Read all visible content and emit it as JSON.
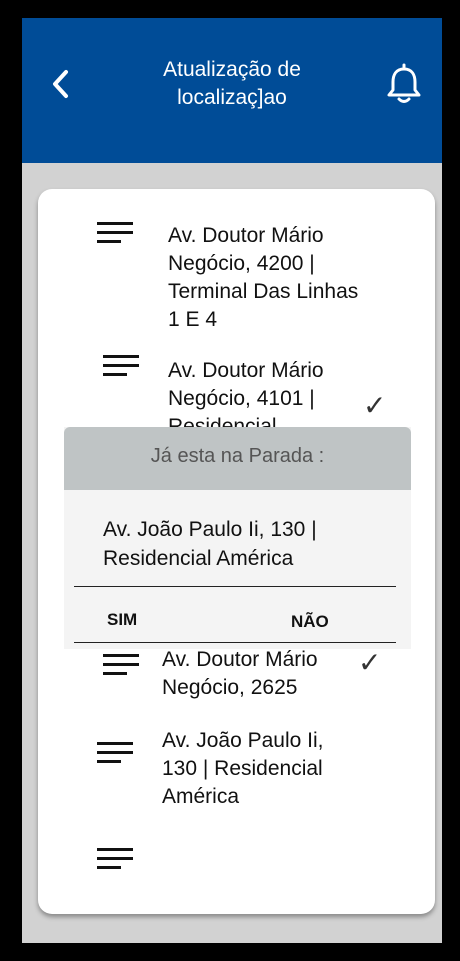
{
  "header": {
    "title_line1": "Atualização de",
    "title_line2": "localizaç]ao",
    "back_icon": "chevron-left-icon",
    "bell_icon": "bell-icon"
  },
  "stops": [
    {
      "address": "Av. Doutor Mário Negócio, 4200 | Terminal Das Linhas 1 E 4"
    },
    {
      "address": "Av. Doutor Mário Negócio, 4101 | Residencial",
      "checked": true
    },
    {
      "address": "Av. Doutor Mário Negócio, 2625",
      "checked": true
    },
    {
      "address": "Av. João Paulo Ii, 130 | Residencial América"
    },
    {
      "address": ""
    }
  ],
  "dialog": {
    "title": "Já esta na Parada :",
    "address": "Av. João Paulo Ii, 130 | Residencial América",
    "yes_label": "SIM",
    "no_label": "NÃO"
  },
  "colors": {
    "header": "#004c97",
    "dialog_header": "#bfc4c5"
  },
  "check_glyph": "✓"
}
